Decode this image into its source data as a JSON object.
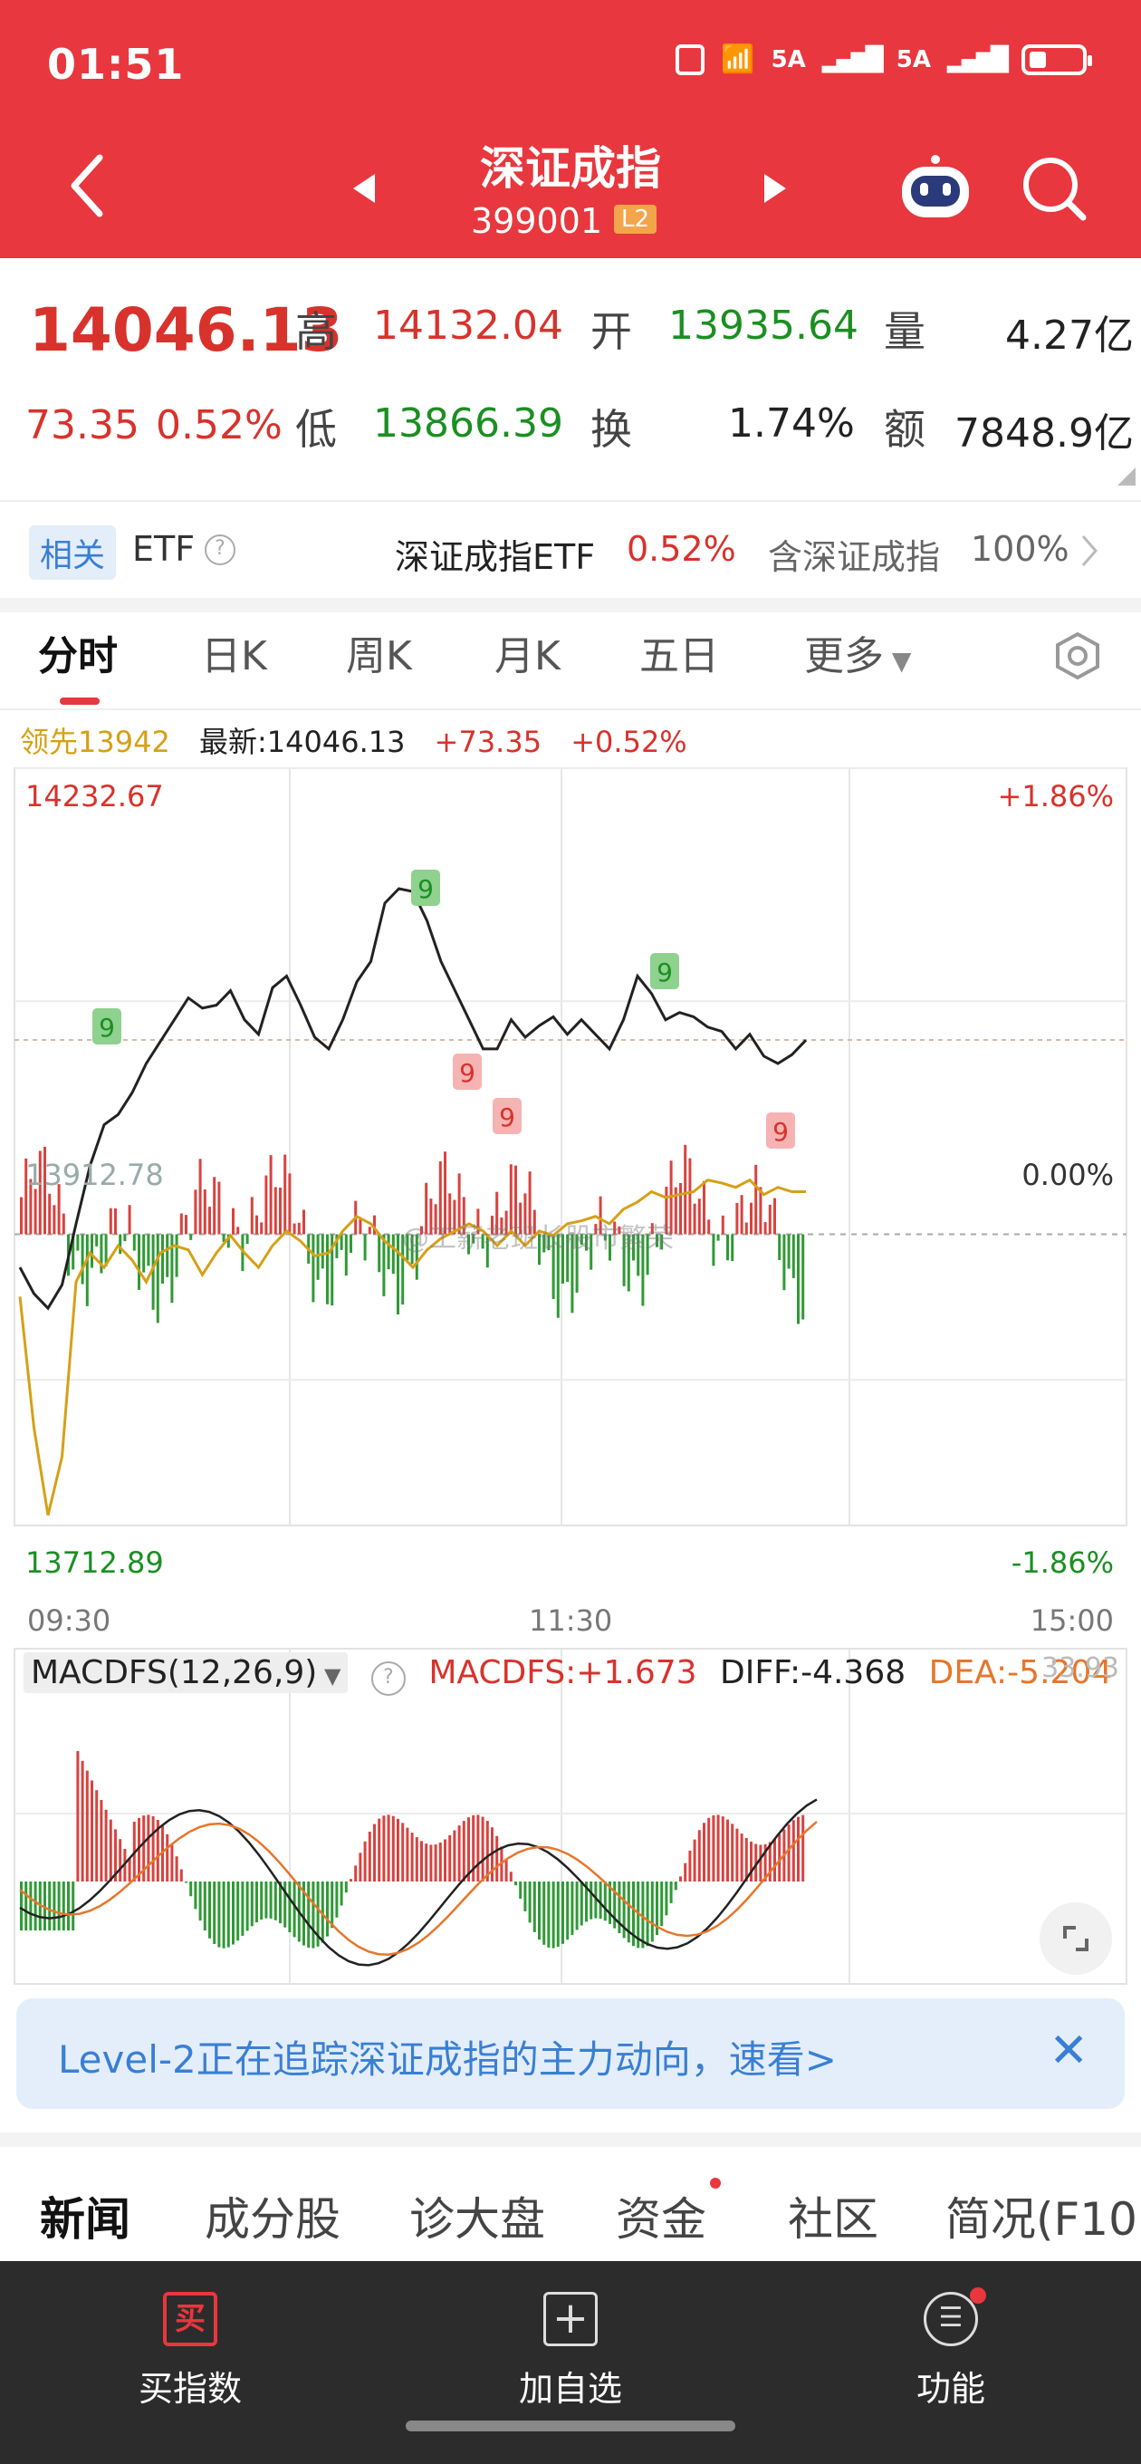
{
  "status_bar": {
    "time": "01:51",
    "network": "5A"
  },
  "header": {
    "title": "深证成指",
    "code": "399001",
    "badge": "L2"
  },
  "quote": {
    "price": "14046.13",
    "change": "73.35",
    "change_pct": "0.52%",
    "high_label": "高",
    "high": "14132.04",
    "open_label": "开",
    "open": "13935.64",
    "volume_label": "量",
    "volume": "4.27亿",
    "low_label": "低",
    "low": "13866.39",
    "turnover_label": "换",
    "turnover": "1.74%",
    "amount_label": "额",
    "amount": "7848.9亿"
  },
  "etf": {
    "tag": "相关",
    "label": "ETF",
    "name": "深证成指ETF",
    "pct": "0.52%",
    "contain_label": "含深证成指",
    "contain_pct": "100%"
  },
  "tabs": [
    "分时",
    "日K",
    "周K",
    "月K",
    "五日",
    "更多"
  ],
  "info": {
    "leader": "领先13942",
    "latest": "最新:14046.13",
    "change": "+73.35",
    "change_pct": "+0.52%"
  },
  "chart_labels": {
    "top_left": "14232.67",
    "top_right": "+1.86%",
    "mid_left": "13912.78",
    "mid_right": "0.00%",
    "bottom_left": "13712.89",
    "bottom_right": "-1.86%",
    "time_start": "09:30",
    "time_mid": "11:30",
    "time_end": "15:00",
    "watermark": "@工薪老班长股市繁荣",
    "marker": "9"
  },
  "chart_data": {
    "type": "line",
    "x_label_ticks": [
      "09:30",
      "11:30",
      "15:00"
    ],
    "ylim": [
      13712.89,
      14232.67
    ],
    "y_ref": 13912.78,
    "series": [
      {
        "name": "最新",
        "values": [
          13890,
          13872,
          13862,
          13878,
          13920,
          13960,
          13988,
          13995,
          14010,
          14030,
          14045,
          14060,
          14075,
          14068,
          14070,
          14080,
          14060,
          14050,
          14082,
          14090,
          14070,
          14048,
          14040,
          14060,
          14086,
          14100,
          14140,
          14150,
          14148,
          14128,
          14100,
          14080,
          14060,
          14040,
          14040,
          14060,
          14048,
          14056,
          14062,
          14050,
          14060,
          14050,
          14040,
          14060,
          14090,
          14078,
          14060,
          14065,
          14062,
          14055,
          14052,
          14040,
          14050,
          14035,
          14030,
          14036,
          14046
        ]
      },
      {
        "name": "领先",
        "values": [
          13870,
          13780,
          13720,
          13760,
          13880,
          13900,
          13890,
          13905,
          13895,
          13880,
          13900,
          13905,
          13902,
          13885,
          13900,
          13912,
          13900,
          13890,
          13905,
          13915,
          13908,
          13898,
          13900,
          13915,
          13925,
          13920,
          13908,
          13900,
          13890,
          13902,
          13910,
          13915,
          13920,
          13915,
          13905,
          13915,
          13905,
          13915,
          13912,
          13920,
          13922,
          13925,
          13920,
          13930,
          13935,
          13942,
          13938,
          13940,
          13942,
          13950,
          13948,
          13945,
          13950,
          13940,
          13945,
          13942,
          13942
        ]
      }
    ]
  },
  "macd": {
    "name": "MACDFS(12,26,9)",
    "macdfs": "MACDFS:+1.673",
    "diff": "DIFF:-4.368",
    "dea": "DEA:-5.204",
    "top": "33.93"
  },
  "banner": {
    "text": "Level-2正在追踪深证成指的主力动向，速看>",
    "close": "✕"
  },
  "news_tabs": [
    "新闻",
    "成分股",
    "诊大盘",
    "资金",
    "社区",
    "简况(F10"
  ],
  "bottom_bar": {
    "buy": "买指数",
    "buy_icon": "买",
    "add": "加自选",
    "func": "功能"
  }
}
